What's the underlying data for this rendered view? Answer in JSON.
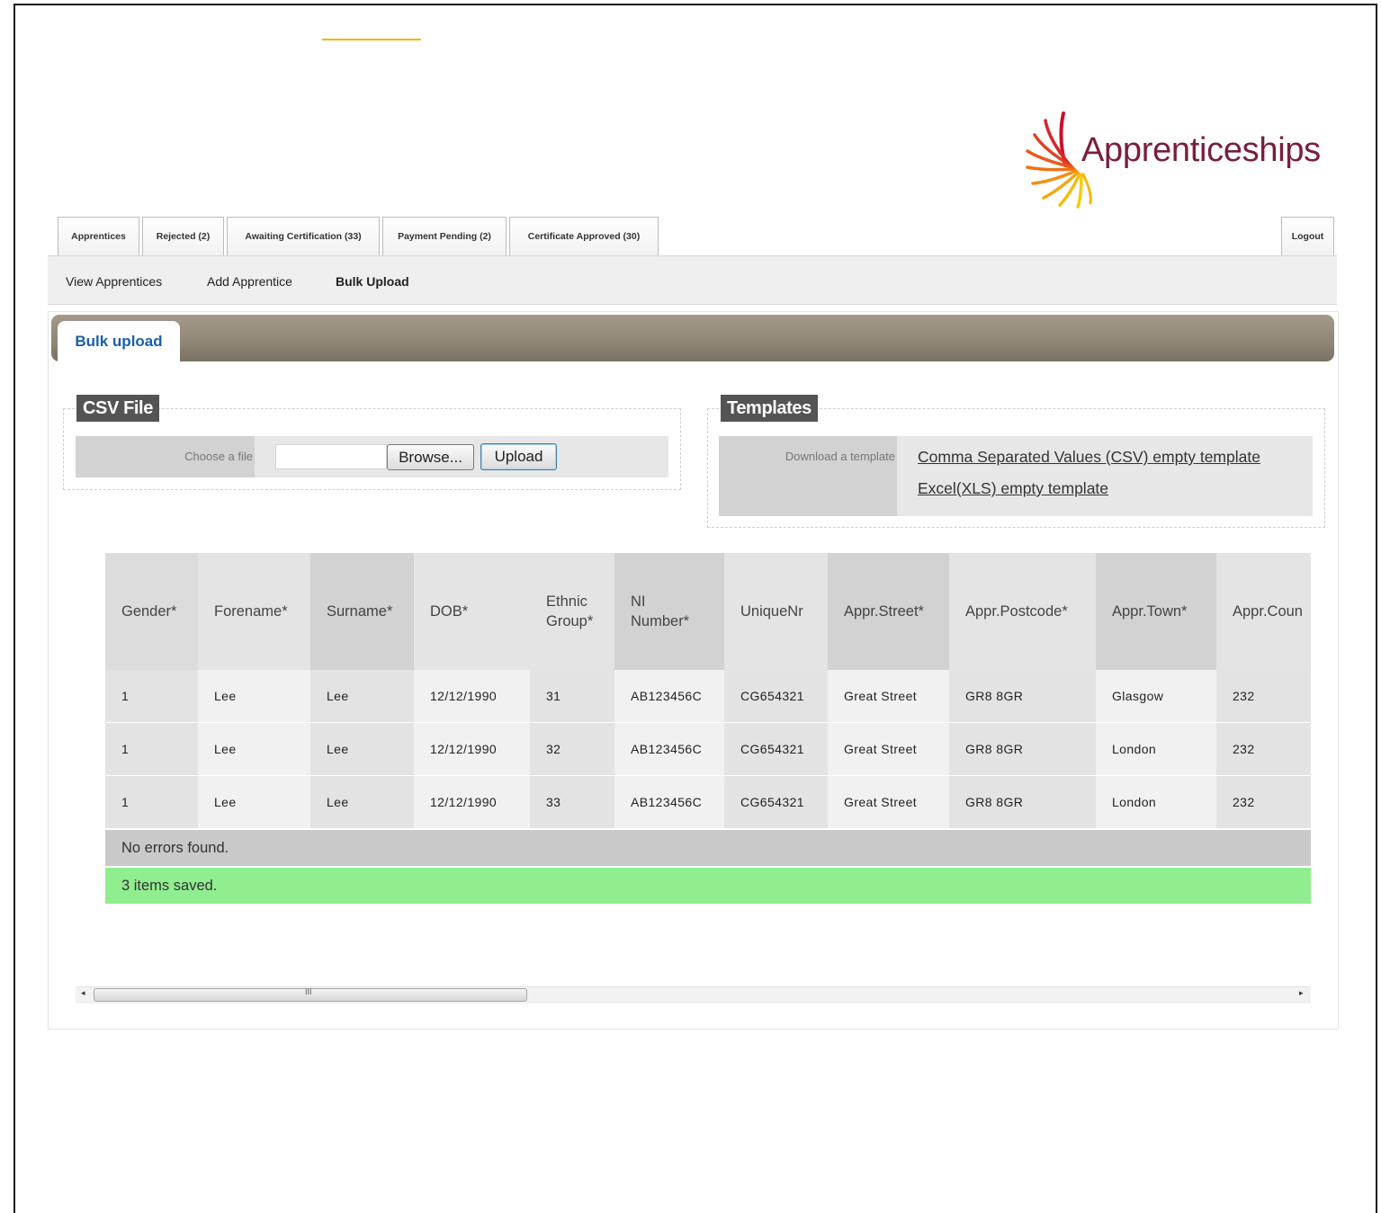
{
  "brand": {
    "logo_text": "Apprenticeships"
  },
  "tabs": [
    {
      "label": "Apprentices"
    },
    {
      "label": "Rejected (2)"
    },
    {
      "label": "Awaiting Certification (33)"
    },
    {
      "label": "Payment Pending (2)"
    },
    {
      "label": "Certificate Approved (30)"
    }
  ],
  "logout_label": "Logout",
  "subnav": [
    {
      "label": "View Apprentices"
    },
    {
      "label": "Add Apprentice"
    },
    {
      "label": "Bulk Upload",
      "active": true
    }
  ],
  "section_title": "Bulk upload",
  "csv": {
    "legend": "CSV File",
    "choose_label": "Choose a file",
    "file_value": "",
    "browse_label": "Browse...",
    "upload_label": "Upload"
  },
  "templates": {
    "legend": "Templates",
    "download_label": "Download a template",
    "csv_link": "Comma Separated Values (CSV) empty template",
    "xls_link": "Excel(XLS) empty template"
  },
  "table": {
    "headers": [
      "Gender*",
      "Forename*",
      "Surname*",
      "DOB*",
      "Ethnic\nGroup*",
      "NI\nNumber*",
      "UniqueNr",
      "Appr.Street*",
      "Appr.Postcode*",
      "Appr.Town*",
      "Appr.Coun"
    ],
    "rows": [
      [
        "1",
        "Lee",
        "Lee",
        "12/12/1990",
        "31",
        "AB123456C",
        "CG654321",
        "Great Street",
        "GR8 8GR",
        "Glasgow",
        "232"
      ],
      [
        "1",
        "Lee",
        "Lee",
        "12/12/1990",
        "32",
        "AB123456C",
        "CG654321",
        "Great Street",
        "GR8 8GR",
        "London",
        "232"
      ],
      [
        "1",
        "Lee",
        "Lee",
        "12/12/1990",
        "33",
        "AB123456C",
        "CG654321",
        "Great Street",
        "GR8 8GR",
        "London",
        "232"
      ]
    ],
    "errors_text": "No errors found.",
    "saved_text": "3 items saved."
  },
  "scrollbar": {
    "grip": "III",
    "left_arrow": "◂",
    "right_arrow": "▸"
  },
  "colors": {
    "brand": "#7a1e3d",
    "success": "#90ee90",
    "header_dark": "#d2d2d2",
    "header_light": "#e4e4e4"
  }
}
